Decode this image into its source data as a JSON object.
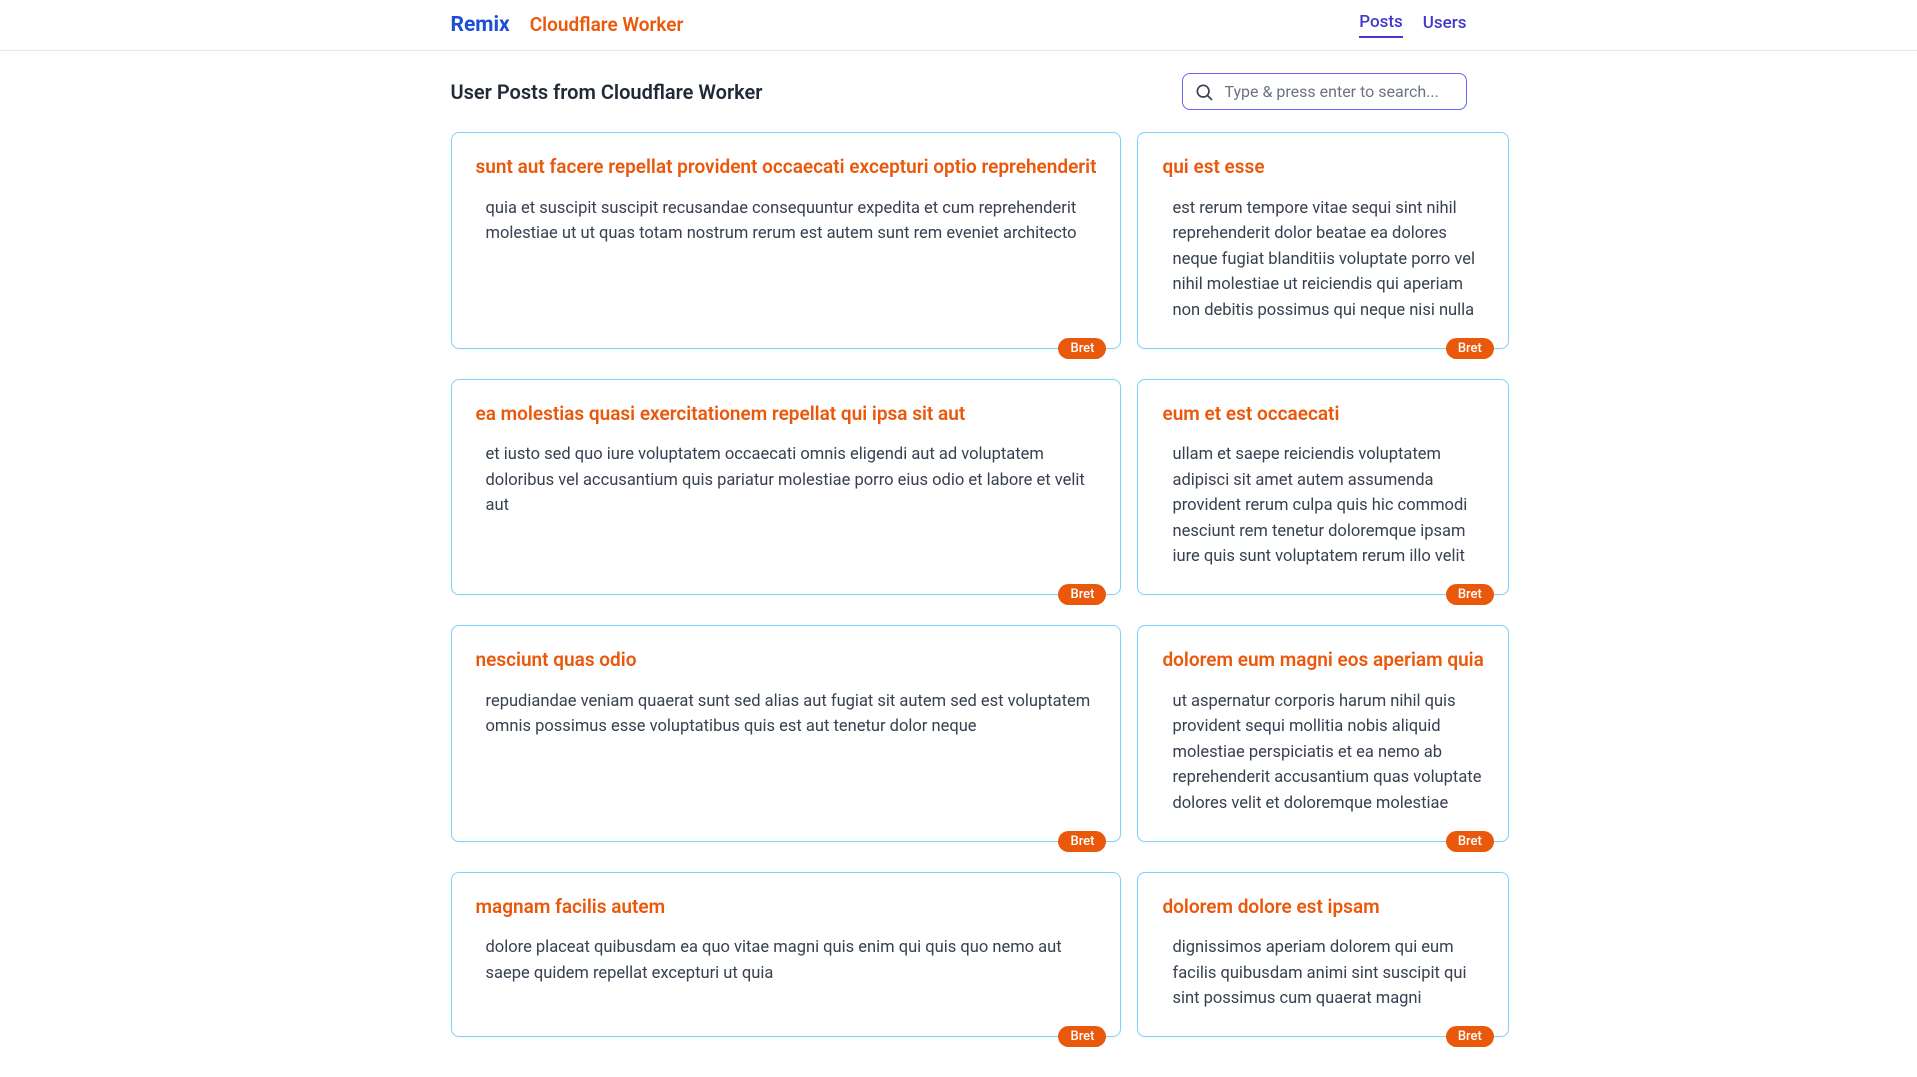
{
  "header": {
    "brand_remix": "Remix",
    "brand_cw": "Cloudflare Worker",
    "nav": {
      "posts": "Posts",
      "users": "Users"
    }
  },
  "page": {
    "title": "User Posts from Cloudflare Worker"
  },
  "search": {
    "placeholder": "Type & press enter to search..."
  },
  "posts": [
    {
      "title": "sunt aut facere repellat provident occaecati excepturi optio reprehenderit",
      "body": "quia et suscipit suscipit recusandae consequuntur expedita et cum reprehenderit molestiae ut ut quas totam nostrum rerum est autem sunt rem eveniet architecto",
      "author": "Bret"
    },
    {
      "title": "qui est esse",
      "body": "est rerum tempore vitae sequi sint nihil reprehenderit dolor beatae ea dolores neque fugiat blanditiis voluptate porro vel nihil molestiae ut reiciendis qui aperiam non debitis possimus qui neque nisi nulla",
      "author": "Bret"
    },
    {
      "title": "ea molestias quasi exercitationem repellat qui ipsa sit aut",
      "body": "et iusto sed quo iure voluptatem occaecati omnis eligendi aut ad voluptatem doloribus vel accusantium quis pariatur molestiae porro eius odio et labore et velit aut",
      "author": "Bret"
    },
    {
      "title": "eum et est occaecati",
      "body": "ullam et saepe reiciendis voluptatem adipisci sit amet autem assumenda provident rerum culpa quis hic commodi nesciunt rem tenetur doloremque ipsam iure quis sunt voluptatem rerum illo velit",
      "author": "Bret"
    },
    {
      "title": "nesciunt quas odio",
      "body": "repudiandae veniam quaerat sunt sed alias aut fugiat sit autem sed est voluptatem omnis possimus esse voluptatibus quis est aut tenetur dolor neque",
      "author": "Bret"
    },
    {
      "title": "dolorem eum magni eos aperiam quia",
      "body": "ut aspernatur corporis harum nihil quis provident sequi mollitia nobis aliquid molestiae perspiciatis et ea nemo ab reprehenderit accusantium quas voluptate dolores velit et doloremque molestiae",
      "author": "Bret"
    },
    {
      "title": "magnam facilis autem",
      "body": "dolore placeat quibusdam ea quo vitae magni quis enim qui quis quo nemo aut saepe quidem repellat excepturi ut quia",
      "author": "Bret"
    },
    {
      "title": "dolorem dolore est ipsam",
      "body": "dignissimos aperiam dolorem qui eum facilis quibusdam animi sint suscipit qui sint possimus cum quaerat magni",
      "author": "Bret"
    }
  ]
}
